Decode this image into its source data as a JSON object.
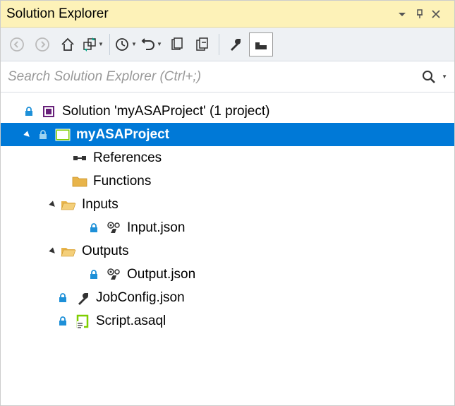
{
  "title": "Solution Explorer",
  "search": {
    "placeholder": "Search Solution Explorer (Ctrl+;)"
  },
  "tree": {
    "solution": "Solution 'myASAProject' (1 project)",
    "project": "myASAProject",
    "references": "References",
    "functions": "Functions",
    "inputs": "Inputs",
    "input_json": "Input.json",
    "outputs": "Outputs",
    "output_json": "Output.json",
    "jobconfig": "JobConfig.json",
    "script": "Script.asaql"
  }
}
